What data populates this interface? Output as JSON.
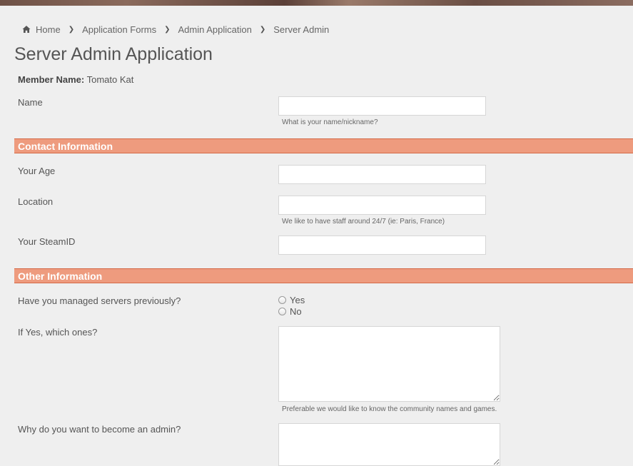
{
  "breadcrumb": {
    "home": "Home",
    "items": [
      "Application Forms",
      "Admin Application",
      "Server Admin"
    ]
  },
  "page_title": "Server Admin Application",
  "member": {
    "label": "Member Name:",
    "value": "Tomato Kat"
  },
  "fields": {
    "name": {
      "label": "Name",
      "value": "",
      "hint": "What is your name/nickname?"
    },
    "age": {
      "label": "Your Age",
      "value": ""
    },
    "location": {
      "label": "Location",
      "value": "",
      "hint": "We like to have staff around 24/7 (ie: Paris, France)"
    },
    "steamid": {
      "label": "Your SteamID",
      "value": ""
    },
    "managed": {
      "label": "Have you managed servers previously?",
      "options": [
        "Yes",
        "No"
      ]
    },
    "which": {
      "label": "If Yes, which ones?",
      "value": "",
      "hint": "Preferable we would like to know the community names and games."
    },
    "why": {
      "label": "Why do you want to become an admin?",
      "value": ""
    }
  },
  "sections": {
    "contact": "Contact Information",
    "other": "Other Information"
  },
  "colors": {
    "section_bg": "#ee9b7e",
    "section_border": "#d46a48",
    "page_bg": "#efefef"
  }
}
